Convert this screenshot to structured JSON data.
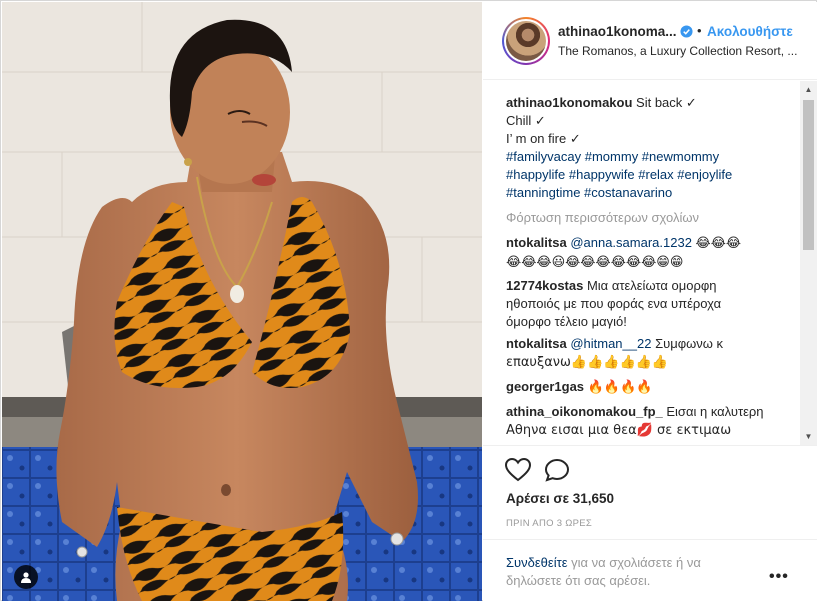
{
  "post": {
    "username": "athinao1konoma...",
    "follow_label": "Ακολουθήστε",
    "dot": "•",
    "location": "The Romanos, a Luxury Collection Resort, ...",
    "caption_user": "athinao1konomakou",
    "caption_lines": [
      "Sit back ✓",
      "Chill ✓",
      "I’ m on fire ✓"
    ],
    "hashtags": [
      "#familyvacay #mommy #newmommy",
      "#happylife #happywife #relax #enjoylife",
      "#tanningtime #costanavarino"
    ],
    "load_more": "Φόρτωση περισσότερων σχολίων",
    "comments": [
      {
        "user": "ntokalitsa",
        "mention": "@anna.samara.1232",
        "text": "😂😂😂",
        "text2": "😂😂😂😃😂😂😂😂😂😂😁😁"
      },
      {
        "user": "12774kostas",
        "text": "Μια ατελείωτα ομορφη",
        "text2": "ηθοποιός με που φοράς ενα υπέροχα",
        "text3": "όμορφο τέλειο μαγιό!"
      },
      {
        "user": "ntokalitsa",
        "mention": "@hitman__22",
        "text": "Συμφωνω κ",
        "text2": "επαυξανω👍👍👍👍👍👍"
      },
      {
        "user": "georger1gas",
        "text": "🔥🔥🔥🔥"
      },
      {
        "user": "athina_oikonomakou_fp_",
        "text": "Εισαι η καλυτερη",
        "text2": "Αθηνα εισαι μια θεα💋 σε εκτιμαω"
      }
    ],
    "likes": "Αρέσει σε 31,650",
    "time": "ΠΡΙΝ ΑΠΟ 3 ΩΡΕΣ",
    "login_link": "Συνδεθείτε",
    "login_text": " για να σχολιάσετε ή να δηλώσετε ότι σας αρέσει.",
    "more_icon": "•••"
  },
  "icons": {
    "heart": "heart-outline-icon",
    "comment": "comment-bubble-icon",
    "verified": "verified-badge-icon",
    "user_tag": "user-tag-icon"
  },
  "colors": {
    "link": "#003569",
    "follow": "#3897f0",
    "muted": "#999999"
  }
}
